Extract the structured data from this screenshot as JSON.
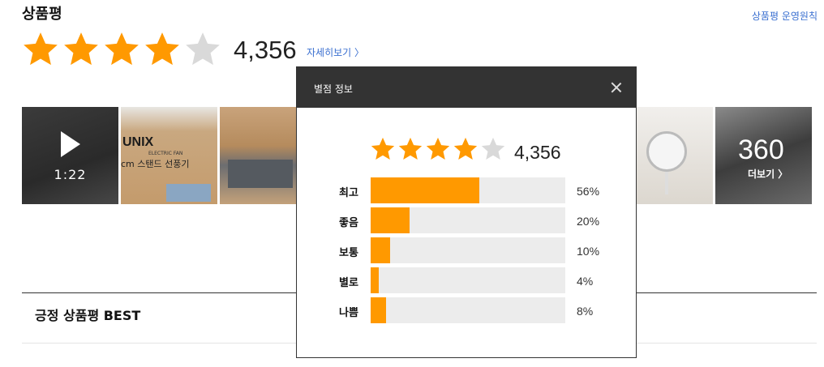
{
  "header": {
    "title": "상품평",
    "policy_link": "상품평 운영원칙"
  },
  "summary": {
    "rating": 4,
    "max_rating": 5,
    "review_count": "4,356",
    "detail_link": "자세히보기 〉"
  },
  "gallery": {
    "video_duration": "1:22",
    "box_text_1": "UNIX",
    "box_text_1_sub": "ELECTRIC FAN",
    "box_text_2": "cm 스탠드 선풍기",
    "more_count": "360",
    "more_label": "더보기 〉"
  },
  "best_section": {
    "title": "긍정 상품평 BEST"
  },
  "colors": {
    "star_filled": "#ff9900",
    "star_empty": "#d9d9d9",
    "bar_fill": "#ff9900",
    "bar_track": "#ececec",
    "link": "#3a6fd0",
    "modal_header": "#333333"
  },
  "modal": {
    "title": "별점 정보",
    "close_icon": "close-icon",
    "rating": 4,
    "max_rating": 5,
    "review_count": "4,356",
    "distribution": [
      {
        "label": "최고",
        "percent": 56,
        "percent_text": "56%"
      },
      {
        "label": "좋음",
        "percent": 20,
        "percent_text": "20%"
      },
      {
        "label": "보통",
        "percent": 10,
        "percent_text": "10%"
      },
      {
        "label": "별로",
        "percent": 4,
        "percent_text": "4%"
      },
      {
        "label": "나쁨",
        "percent": 8,
        "percent_text": "8%"
      }
    ]
  }
}
